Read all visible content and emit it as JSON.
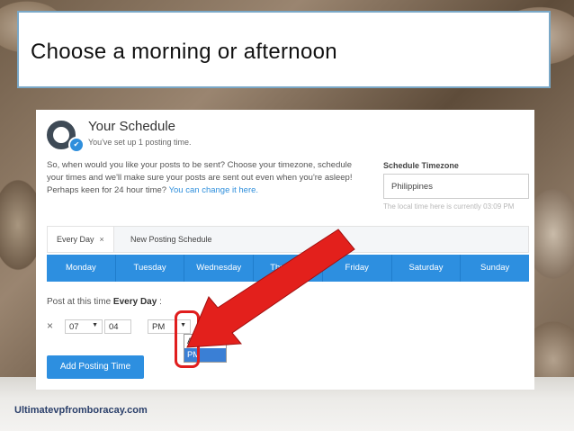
{
  "slide": {
    "title": "Choose a morning or afternoon",
    "footer_brand": "Ultimatevpfromboracay.com"
  },
  "schedule": {
    "heading": "Your Schedule",
    "subheading": "You've set up 1 posting time.",
    "description_1": "So, when would you like your posts to be sent? Choose your timezone, schedule your times and we'll make sure your posts are sent out even when you're asleep!",
    "description_2": "Perhaps keen for 24 hour time?",
    "change_link": "You can change it here."
  },
  "timezone": {
    "label": "Schedule Timezone",
    "value": "Philippines",
    "note": "The local time here is currently 03:09 PM"
  },
  "tabs": [
    {
      "label": "Every Day",
      "close": "×"
    },
    {
      "label": "New Posting Schedule"
    }
  ],
  "days": [
    "Monday",
    "Tuesday",
    "Wednesday",
    "Thursday",
    "Friday",
    "Saturday",
    "Sunday"
  ],
  "post_at": {
    "prefix": "Post at this time",
    "bold": "Every Day",
    "suffix": ":"
  },
  "time_row": {
    "remove": "×",
    "hour": "07",
    "minute": "04",
    "period": "PM",
    "period_options": [
      "AM",
      "PM"
    ]
  },
  "add_button": "Add Posting Time",
  "colors": {
    "accent": "#2d8fe0",
    "highlight": "#e01e1e"
  }
}
